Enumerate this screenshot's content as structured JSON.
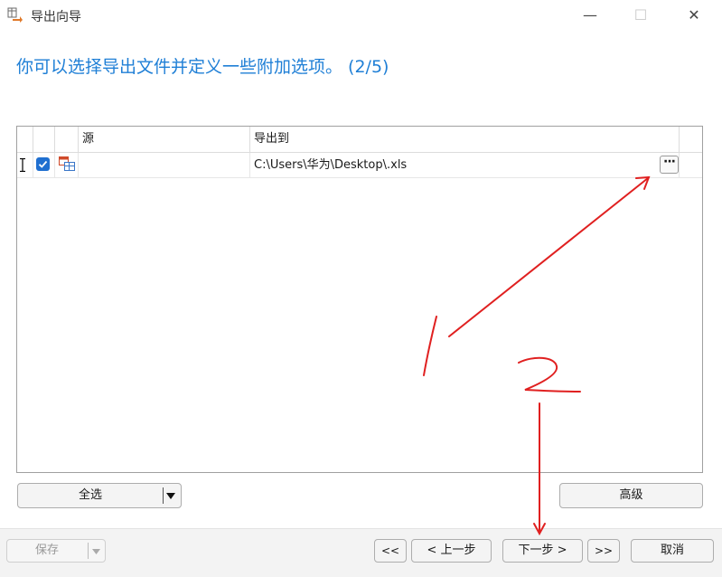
{
  "window": {
    "title": "导出向导",
    "minimize_glyph": "—",
    "maximize_glyph": "☐",
    "close_glyph": "✕"
  },
  "heading": "你可以选择导出文件并定义一些附加选项。 (2/5)",
  "grid": {
    "columns": [
      "源",
      "导出到"
    ],
    "rows": [
      {
        "checked": true,
        "source": "",
        "export_to": "C:\\Users\\华为\\Desktop\\.xls",
        "browse_label": "···"
      }
    ]
  },
  "buttons": {
    "select_all": "全选",
    "advanced": "高级",
    "save": "保存",
    "first": "<<",
    "prev": "< 上一步",
    "next": "下一步 >",
    "last": ">>",
    "cancel": "取消"
  },
  "annotations": {
    "color": "#e02020",
    "labels": [
      "1",
      "2"
    ]
  }
}
